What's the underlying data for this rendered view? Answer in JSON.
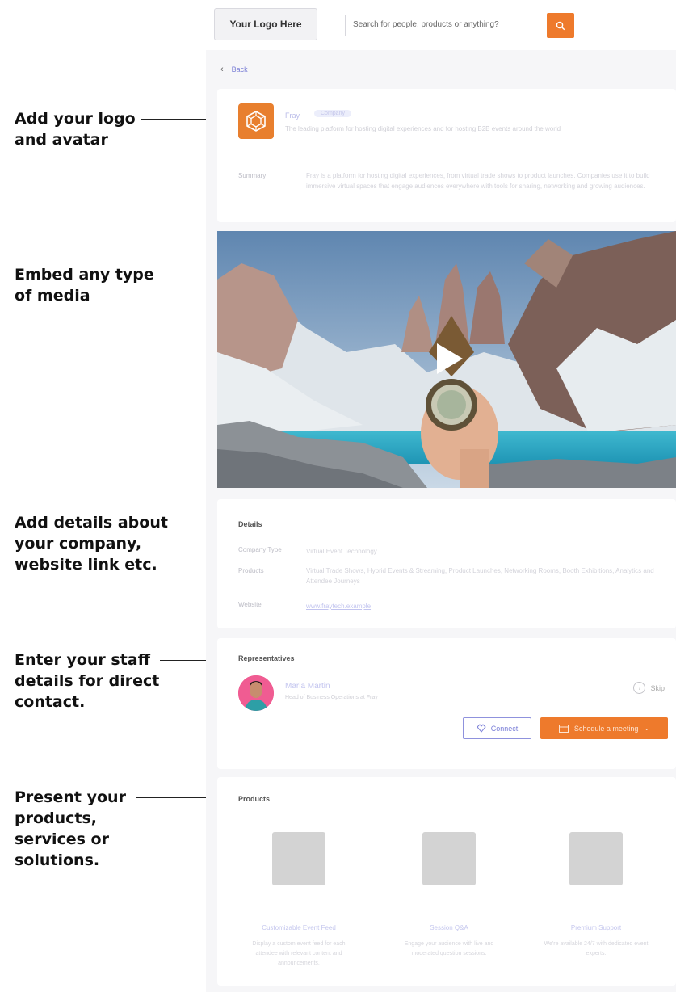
{
  "callouts": [
    {
      "lines": [
        "Add your logo",
        "and avatar"
      ]
    },
    {
      "lines": [
        "Embed any type",
        "of media"
      ]
    },
    {
      "lines": [
        "Add details about",
        "your company,",
        "website link etc."
      ]
    },
    {
      "lines": [
        "Enter your staff",
        "details for direct",
        "contact."
      ]
    },
    {
      "lines": [
        "Present your",
        "products,",
        "services or",
        "solutions."
      ]
    }
  ],
  "header": {
    "logo_label": "Your Logo Here",
    "search_placeholder": "Search for people, products or anything?",
    "search_icon": "search-icon"
  },
  "nav": {
    "back_label": "Back"
  },
  "profile": {
    "company_name": "Fray",
    "company_tag": "Company",
    "tagline": "The leading platform for hosting digital experiences and for hosting B2B events around the world",
    "summary_label": "Summary",
    "summary_text": "Fray is a platform for hosting digital experiences, from virtual trade shows to product launches. Companies use it to build immersive virtual spaces that engage audiences everywhere with tools for sharing, networking and growing audiences."
  },
  "media": {
    "type": "video",
    "play_icon": "play-icon"
  },
  "details": {
    "title": "Details",
    "company_type_label": "Company Type",
    "company_type_value": "Virtual Event Technology",
    "products_label": "Products",
    "products_value": "Virtual Trade Shows, Hybrid Events & Streaming, Product Launches, Networking Rooms, Booth Exhibitions, Analytics and Attendee Journeys",
    "website_label": "Website",
    "website_value": "www.fraytech.example"
  },
  "representatives": {
    "title": "Representatives",
    "name": "Maria Martin",
    "role": "Head of Business Operations at Fray",
    "skip_label": "Skip",
    "connect_label": "Connect",
    "schedule_label": "Schedule a meeting"
  },
  "products": {
    "title": "Products",
    "items": [
      {
        "title": "Customizable Event Feed",
        "desc": "Display a custom event feed for each attendee with relevant content and announcements."
      },
      {
        "title": "Session Q&A",
        "desc": "Engage your audience with live and moderated question sessions."
      },
      {
        "title": "Premium Support",
        "desc": "We're available 24/7 with dedicated event experts."
      }
    ]
  },
  "colors": {
    "accent": "#ee7a2c",
    "link": "#7c80d8",
    "callout_text": "#111111"
  }
}
